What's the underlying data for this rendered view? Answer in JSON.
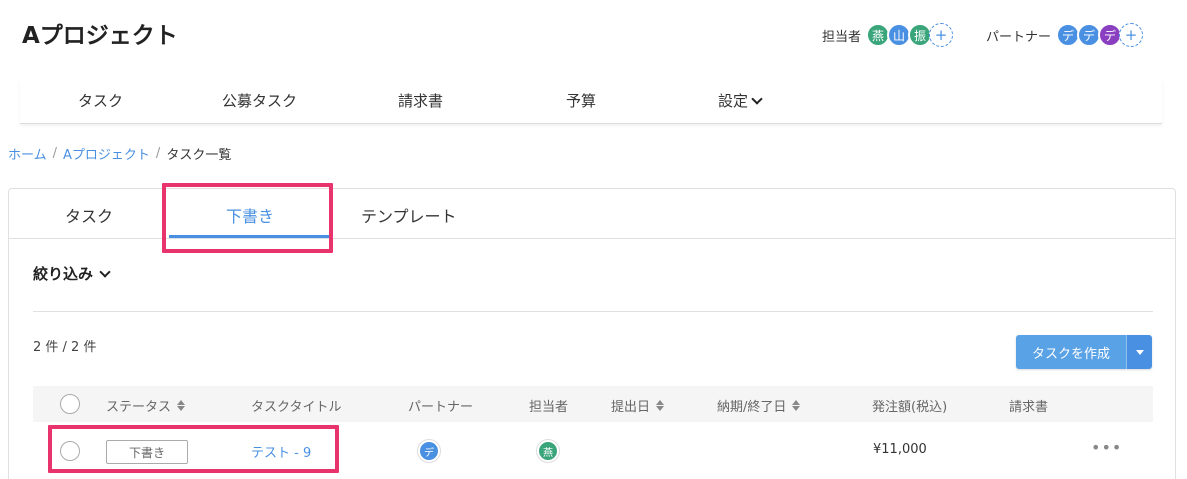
{
  "project": {
    "title": "Aプロジェクト"
  },
  "assignees": {
    "label": "担当者",
    "avatars": [
      {
        "initial": "燕",
        "color": "#3aa57b"
      },
      {
        "initial": "山",
        "color": "#4a90e2"
      },
      {
        "initial": "振",
        "color": "#3aa57b"
      }
    ],
    "add": "+"
  },
  "partners": {
    "label": "パートナー",
    "avatars": [
      {
        "initial": "デ",
        "color": "#4a90e2"
      },
      {
        "initial": "デ",
        "color": "#4a90e2"
      },
      {
        "initial": "デ",
        "color": "#8a3fc0"
      }
    ],
    "add": "+"
  },
  "nav": {
    "items": [
      "タスク",
      "公募タスク",
      "請求書",
      "予算",
      "設定"
    ]
  },
  "breadcrumb": {
    "home": "ホーム",
    "project": "Aプロジェクト",
    "current": "タスク一覧",
    "sep": "/"
  },
  "tabs": {
    "task": "タスク",
    "draft": "下書き",
    "template": "テンプレート",
    "active": "draft"
  },
  "filter": {
    "label": "絞り込み"
  },
  "list": {
    "count": "2 件 / 2 件",
    "create_button": "タスクを作成"
  },
  "table": {
    "headers": {
      "status": "ステータス",
      "title": "タスクタイトル",
      "partner": "パートナー",
      "assignee": "担当者",
      "submit_date": "提出日",
      "due_date": "納期/終了日",
      "amount": "発注額(税込)",
      "invoice": "請求書"
    },
    "rows": [
      {
        "status": "下書き",
        "title": "テスト - 9",
        "partner_initial": "デ",
        "assignee_initial": "燕",
        "amount": "¥11,000",
        "more": "•••"
      }
    ]
  },
  "colors": {
    "accent": "#4a90e2",
    "highlight": "#e8336d",
    "green_avatar": "#3aa57b",
    "purple_avatar": "#8a3fc0"
  }
}
